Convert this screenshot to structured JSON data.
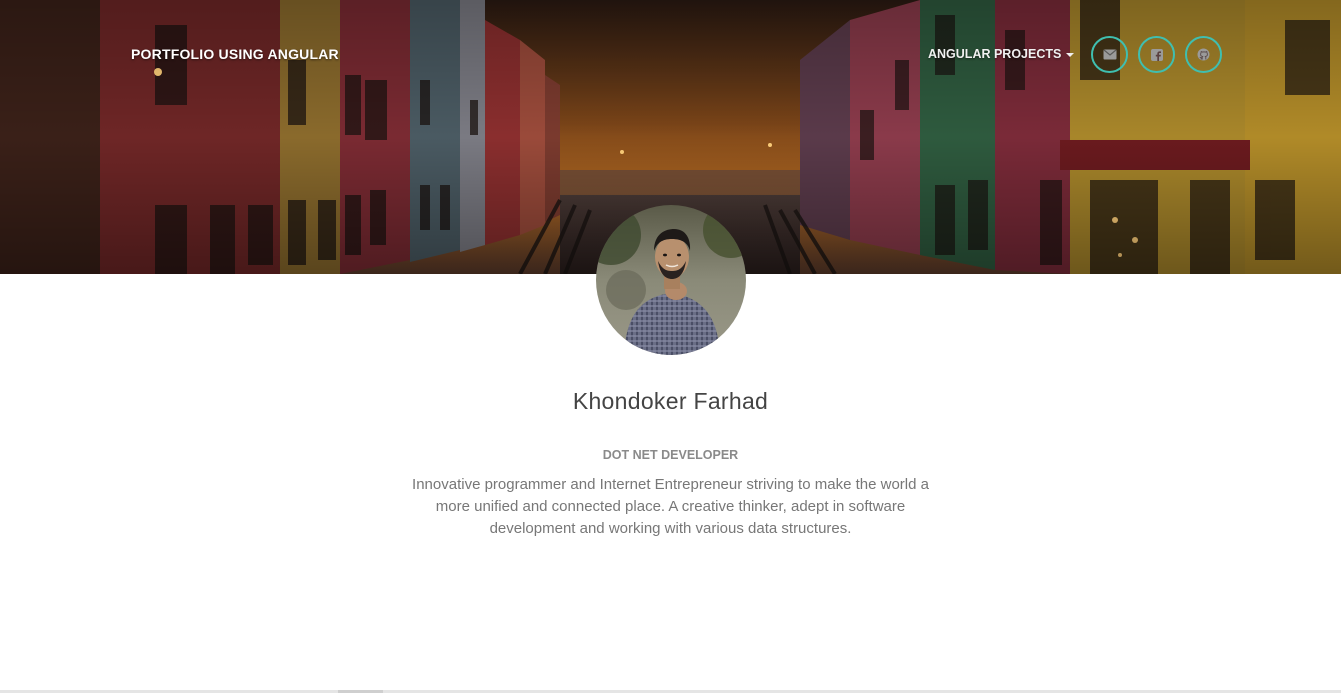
{
  "navbar": {
    "brand": "PORTFOLIO USING ANGULAR",
    "dropdown_label": "ANGULAR PROJECTS",
    "social_links": [
      {
        "icon": "envelope-icon",
        "label": "Email"
      },
      {
        "icon": "facebook-icon",
        "label": "Facebook"
      },
      {
        "icon": "github-icon",
        "label": "GitHub"
      }
    ]
  },
  "profile": {
    "name": "Khondoker Farhad",
    "role": "DOT NET DEVELOPER",
    "bio": "Innovative programmer and Internet Entrepreneur striving to make the world a more unified and connected place. A creative thinker, adept in software development and working with various data structures."
  },
  "colors": {
    "accent": "#3fbfb0",
    "name_text": "#444444",
    "muted_text": "#777777",
    "role_text": "#8a8a8a"
  }
}
